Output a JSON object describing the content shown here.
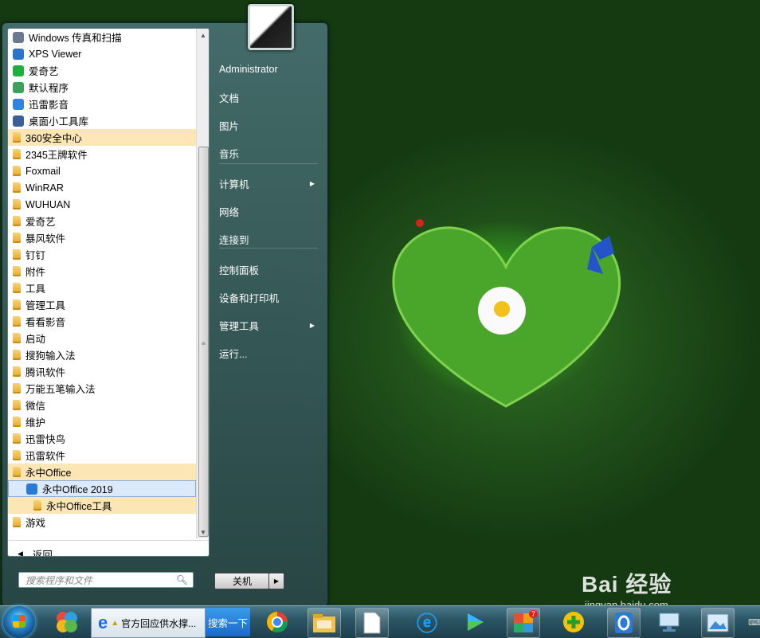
{
  "start_menu": {
    "programs": [
      {
        "label": "Windows 传真和扫描",
        "icon": "fax-scan-icon",
        "highlight": false
      },
      {
        "label": "XPS Viewer",
        "icon": "xps-viewer-icon",
        "highlight": false
      },
      {
        "label": "爱奇艺",
        "icon": "iqiyi-icon",
        "highlight": false
      },
      {
        "label": "默认程序",
        "icon": "default-programs-icon",
        "highlight": false
      },
      {
        "label": "迅雷影音",
        "icon": "xunlei-player-icon",
        "highlight": false
      },
      {
        "label": "桌面小工具库",
        "icon": "gadgets-icon",
        "highlight": false
      },
      {
        "label": "360安全中心",
        "icon": "folder-icon",
        "highlight": true
      },
      {
        "label": "2345王牌软件",
        "icon": "folder-icon",
        "highlight": false
      },
      {
        "label": "Foxmail",
        "icon": "folder-icon",
        "highlight": false
      },
      {
        "label": "WinRAR",
        "icon": "folder-icon",
        "highlight": false
      },
      {
        "label": "WUHUAN",
        "icon": "folder-icon",
        "highlight": false
      },
      {
        "label": "爱奇艺",
        "icon": "folder-icon",
        "highlight": false
      },
      {
        "label": "暴风软件",
        "icon": "folder-icon",
        "highlight": false
      },
      {
        "label": "钉钉",
        "icon": "folder-icon",
        "highlight": false
      },
      {
        "label": "附件",
        "icon": "folder-icon",
        "highlight": false
      },
      {
        "label": "工具",
        "icon": "folder-icon",
        "highlight": false
      },
      {
        "label": "管理工具",
        "icon": "folder-icon",
        "highlight": false
      },
      {
        "label": "看看影音",
        "icon": "folder-icon",
        "highlight": false
      },
      {
        "label": "启动",
        "icon": "folder-icon",
        "highlight": false
      },
      {
        "label": "搜狗输入法",
        "icon": "folder-icon",
        "highlight": false
      },
      {
        "label": "腾讯软件",
        "icon": "folder-icon",
        "highlight": false
      },
      {
        "label": "万能五笔输入法",
        "icon": "folder-icon",
        "highlight": false
      },
      {
        "label": "微信",
        "icon": "folder-icon",
        "highlight": false
      },
      {
        "label": "维护",
        "icon": "folder-icon",
        "highlight": false
      },
      {
        "label": "迅雷快鸟",
        "icon": "folder-icon",
        "highlight": false
      },
      {
        "label": "迅雷软件",
        "icon": "folder-icon",
        "highlight": false
      },
      {
        "label": "永中Office",
        "icon": "folder-icon",
        "highlight": true
      },
      {
        "label": "永中Office 2019",
        "icon": "yozo-office-icon",
        "highlight": false,
        "selected": true,
        "indent": 1
      },
      {
        "label": "永中Office工具",
        "icon": "folder-icon",
        "highlight": true,
        "indent": 2
      },
      {
        "label": "游戏",
        "icon": "folder-icon",
        "highlight": false
      }
    ],
    "back_label": "返回",
    "search_placeholder": "搜索程序和文件",
    "right_items": [
      {
        "label": "Administrator"
      },
      {
        "label": "文档"
      },
      {
        "label": "图片"
      },
      {
        "label": "音乐"
      },
      {
        "label": "计算机",
        "submenu": true
      },
      {
        "label": "网络"
      },
      {
        "label": "连接到"
      },
      {
        "label": "控制面板"
      },
      {
        "label": "设备和打印机"
      },
      {
        "label": "管理工具",
        "submenu": true
      },
      {
        "label": "运行..."
      }
    ],
    "shutdown_label": "关机"
  },
  "taskbar": {
    "ie_window_label": "官方回应供水撑...",
    "search_label": "搜索一下",
    "badge_count": "7"
  },
  "watermark": {
    "brand": "Bai 经验",
    "url": "jingyan.baidu.com"
  },
  "colors": {
    "highlight": "#fde6b6",
    "selected": "#dbe9fa",
    "taskbar": "#2c5665"
  }
}
